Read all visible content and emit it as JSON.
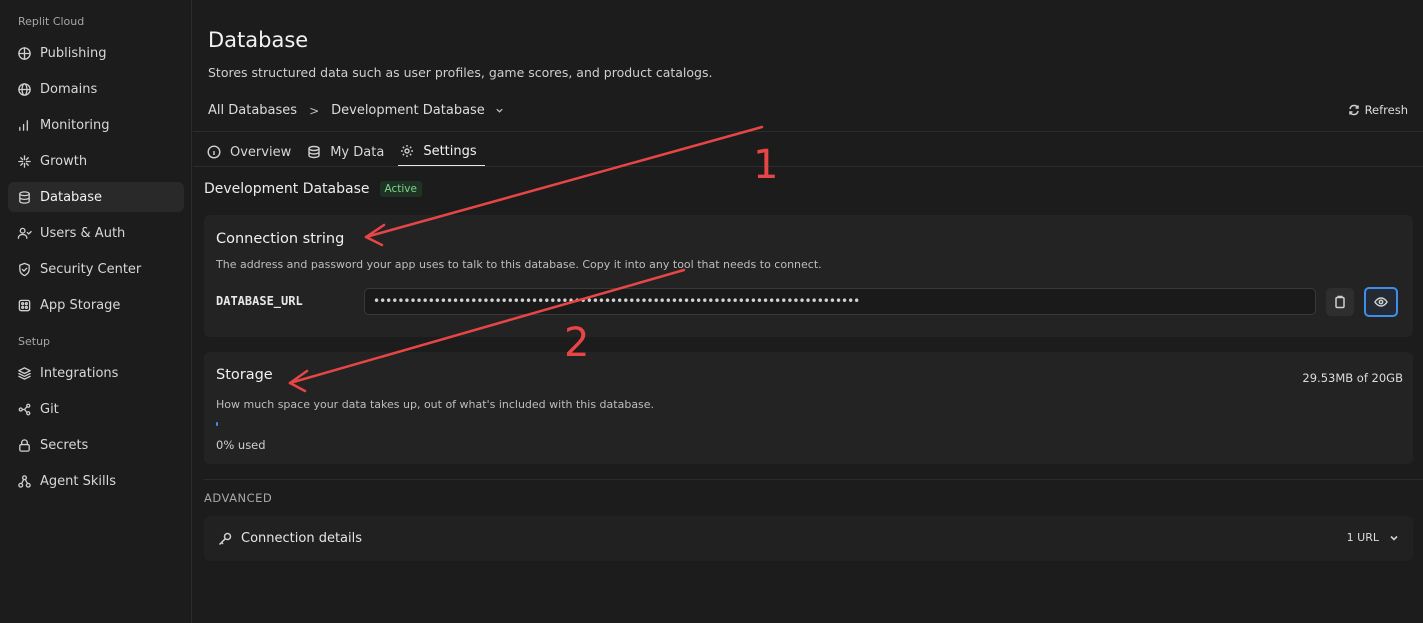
{
  "sidebar": {
    "section_cloud": "Replit Cloud",
    "section_setup": "Setup",
    "items": [
      {
        "label": "Publishing",
        "icon": "publishing-icon"
      },
      {
        "label": "Domains",
        "icon": "globe-icon"
      },
      {
        "label": "Monitoring",
        "icon": "bar-chart-icon"
      },
      {
        "label": "Growth",
        "icon": "growth-icon"
      },
      {
        "label": "Database",
        "icon": "database-icon",
        "active": true
      },
      {
        "label": "Users & Auth",
        "icon": "users-icon"
      },
      {
        "label": "Security Center",
        "icon": "shield-icon"
      },
      {
        "label": "App Storage",
        "icon": "storage-icon"
      }
    ],
    "setup_items": [
      {
        "label": "Integrations",
        "icon": "layers-icon"
      },
      {
        "label": "Git",
        "icon": "git-icon"
      },
      {
        "label": "Secrets",
        "icon": "lock-icon"
      },
      {
        "label": "Agent Skills",
        "icon": "skills-icon"
      }
    ]
  },
  "header": {
    "title": "Database",
    "subtitle": "Stores structured data such as user profiles, game scores, and product catalogs.",
    "breadcrumb_root": "All Databases",
    "breadcrumb_current": "Development Database",
    "refresh_label": "Refresh"
  },
  "tabs": [
    {
      "label": "Overview",
      "icon": "info-icon"
    },
    {
      "label": "My Data",
      "icon": "database-icon"
    },
    {
      "label": "Settings",
      "icon": "gear-icon",
      "active": true
    }
  ],
  "database": {
    "name": "Development Database",
    "status": "Active",
    "status_color": "#7fd38f"
  },
  "connection": {
    "title": "Connection string",
    "description": "The address and password your app uses to talk to this database. Copy it into any tool that needs to connect.",
    "env_key": "DATABASE_URL",
    "masked_value": "••••••••••••••••••••••••••••••••••••••••••••••••••••••••••••••••••••••••••••••••"
  },
  "storage": {
    "title": "Storage",
    "usage": "29.53MB of 20GB",
    "description": "How much space your data takes up, out of what's included with this database.",
    "used_label": "0% used",
    "used_fraction": 0.0
  },
  "advanced": {
    "label": "ADVANCED",
    "connection_details": "Connection details",
    "url_count": "1 URL"
  },
  "annotations": {
    "one": "1",
    "two": "2",
    "color": "#e84646"
  },
  "colors": {
    "accent": "#3f8fe8",
    "background": "#1c1c1c"
  }
}
